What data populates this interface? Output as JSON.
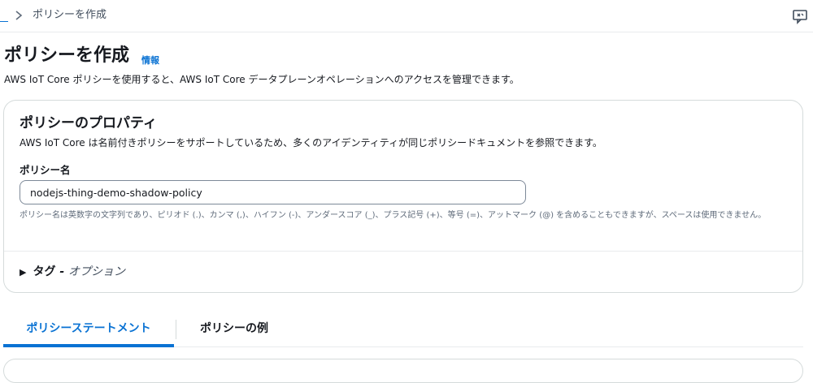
{
  "breadcrumb": {
    "current": "ポリシーを作成"
  },
  "header": {
    "title": "ポリシーを作成",
    "info_link": "情報",
    "description": "AWS IoT Core ポリシーを使用すると、AWS IoT Core データプレーンオペレーションへのアクセスを管理できます。"
  },
  "properties": {
    "title": "ポリシーのプロパティ",
    "description": "AWS IoT Core は名前付きポリシーをサポートしているため、多くのアイデンティティが同じポリシードキュメントを参照できます。",
    "name_label": "ポリシー名",
    "name_value": "nodejs-thing-demo-shadow-policy",
    "name_hint": "ポリシー名は英数字の文字列であり、ピリオド (.)、カンマ (,)、ハイフン (-)、アンダースコア (_)、プラス記号 (+)、等号 (=)、アットマーク (@) を含めることもできますが、スペースは使用できません。",
    "tags_label": "タグ",
    "tags_separator": " - ",
    "tags_optional": "オプション"
  },
  "tabs": [
    {
      "label": "ポリシーステートメント",
      "active": true
    },
    {
      "label": "ポリシーの例",
      "active": false
    }
  ],
  "icons": {
    "breadcrumb_separator": "chevron-right-icon",
    "top_right": "feedback-icon",
    "tags_toggle": "caret-right-icon"
  },
  "colors": {
    "accent": "#0972d3",
    "text": "#16191f",
    "border": "#d5dbdb"
  }
}
